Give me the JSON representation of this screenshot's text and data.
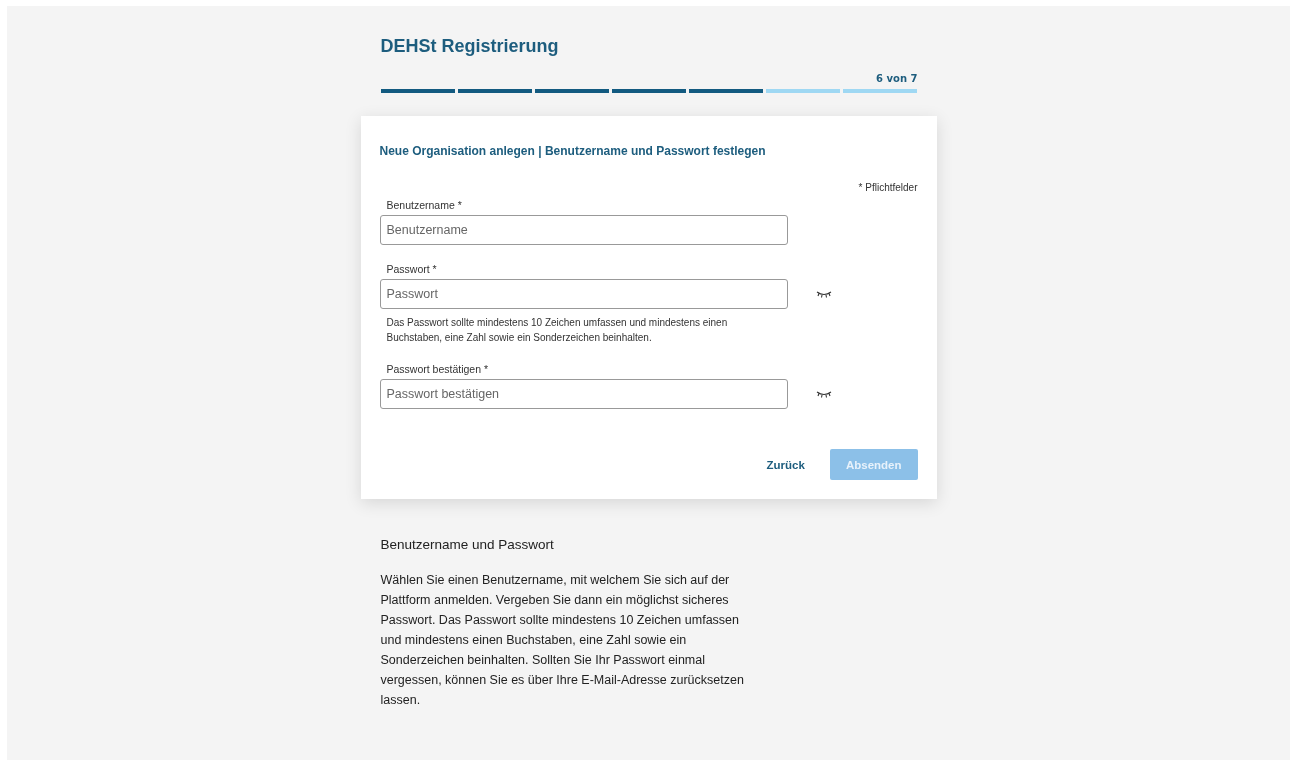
{
  "title": "DEHSt Registrierung",
  "progress": {
    "label": "6 von 7",
    "steps": [
      {
        "completed": true
      },
      {
        "completed": true
      },
      {
        "completed": true
      },
      {
        "completed": true
      },
      {
        "completed": true
      },
      {
        "completed": false
      },
      {
        "completed": false
      }
    ]
  },
  "form": {
    "heading": "Neue Organisation anlegen | Benutzername und Passwort festlegen",
    "required_note": "* Pflichtfelder",
    "fields": [
      {
        "kind": "text",
        "label": "Benutzername *",
        "placeholder": "Benutzername"
      },
      {
        "kind": "password",
        "label": "Passwort *",
        "placeholder": "Passwort",
        "hint": "Das Passwort sollte mindestens 10 Zeichen umfassen und mindestens einen Buchstaben, eine Zahl sowie ein Sonderzeichen beinhalten."
      },
      {
        "kind": "password",
        "label": "Passwort bestätigen *",
        "placeholder": "Passwort bestätigen"
      }
    ],
    "buttons": [
      {
        "kind": "link",
        "label": "Zurück",
        "disabled": false
      },
      {
        "kind": "primary",
        "label": "Absenden",
        "disabled": true
      }
    ]
  },
  "help": {
    "heading": "Benutzername und Passwort",
    "text": "Wählen Sie einen Benutzername, mit welchem Sie sich auf der Plattform anmelden. Vergeben Sie dann ein möglichst sicheres Passwort. Das Passwort sollte mindestens 10 Zeichen umfassen und mindestens einen Buchstaben, eine Zahl sowie ein Sonderzeichen beinhalten. Sollten Sie Ihr Passwort einmal vergessen, können Sie es über Ihre E-Mail-Adresse zurücksetzen lassen."
  }
}
